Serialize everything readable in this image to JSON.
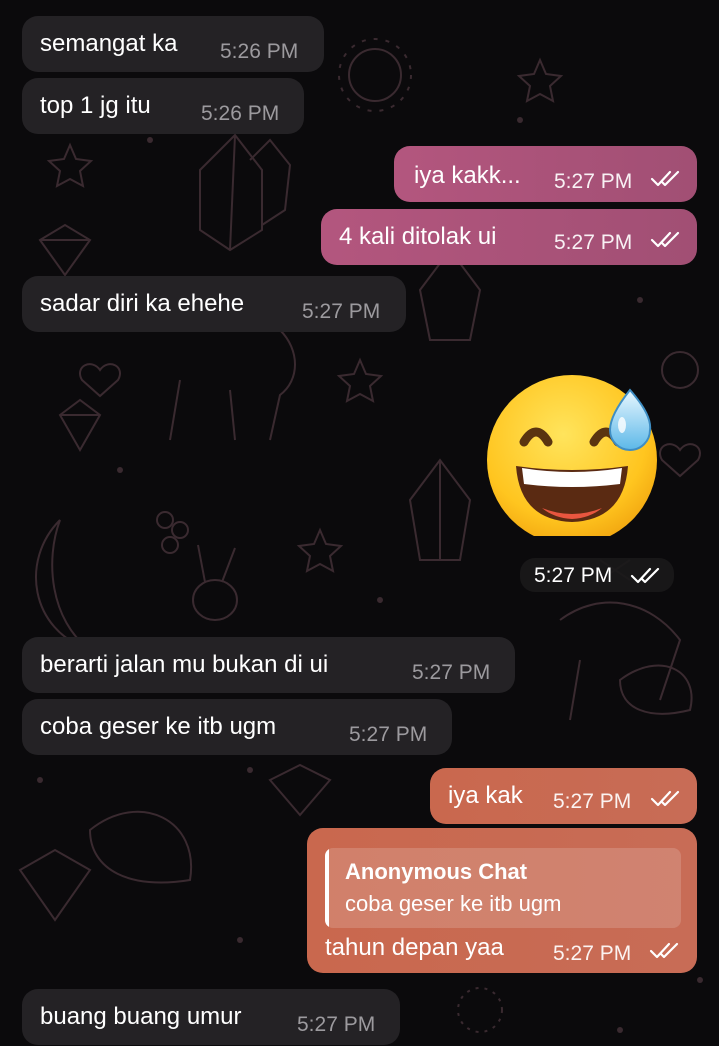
{
  "chat": {
    "messages": [
      {
        "id": "m1",
        "direction": "incoming",
        "text": "semangat ka",
        "time": "5:26 PM"
      },
      {
        "id": "m2",
        "direction": "incoming",
        "text": "top 1 jg itu",
        "time": "5:26 PM"
      },
      {
        "id": "m3",
        "direction": "outgoing",
        "text": "iya kakk...",
        "time": "5:27 PM",
        "status": "read"
      },
      {
        "id": "m4",
        "direction": "outgoing",
        "text": "4 kali ditolak ui",
        "time": "5:27 PM",
        "status": "read"
      },
      {
        "id": "m5",
        "direction": "incoming",
        "text": "sadar diri ka ehehe",
        "time": "5:27 PM"
      },
      {
        "id": "m6",
        "direction": "outgoing",
        "type": "emoji",
        "emoji": "grinning-face-with-sweat",
        "time": "5:27 PM",
        "status": "read"
      },
      {
        "id": "m7",
        "direction": "incoming",
        "text": "berarti jalan mu bukan di ui",
        "time": "5:27 PM"
      },
      {
        "id": "m8",
        "direction": "incoming",
        "text": "coba geser ke itb ugm",
        "time": "5:27 PM"
      },
      {
        "id": "m9",
        "direction": "outgoing",
        "text": "iya kak",
        "time": "5:27 PM",
        "status": "read"
      },
      {
        "id": "m10",
        "direction": "outgoing",
        "text": "tahun depan yaa",
        "time": "5:27 PM",
        "status": "read",
        "reply_to": {
          "sender": "Anonymous Chat",
          "text": "coba geser ke itb ugm"
        }
      },
      {
        "id": "m11",
        "direction": "incoming",
        "text": "buang buang umur",
        "time": "5:27 PM"
      }
    ]
  },
  "theme": {
    "background": "#0b0a0c",
    "incoming_bubble": "#242225",
    "outgoing_bubble_pink": "#a94f77",
    "outgoing_bubble_orange": "#c9684e",
    "wallpaper_doodle": "#3a2a30"
  },
  "icons": {
    "read_status": "double-check-icon",
    "wallpaper": "doodle-pattern"
  }
}
